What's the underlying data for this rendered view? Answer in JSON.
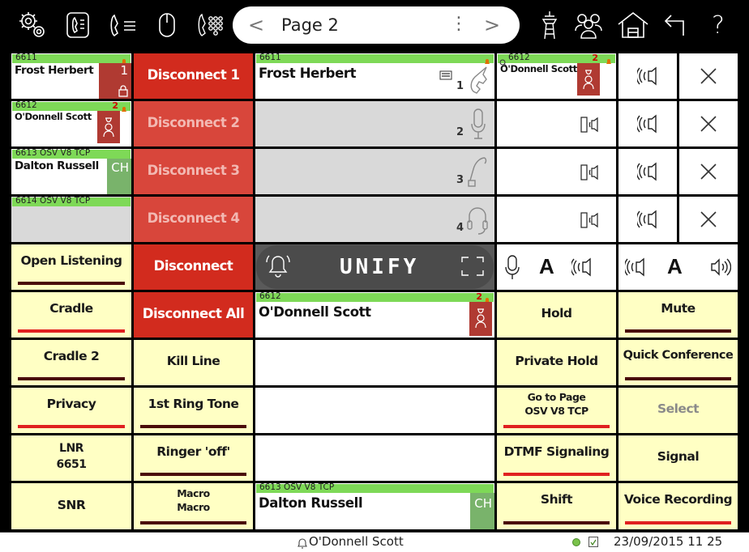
{
  "toolbar": {
    "icons": [
      "settings-icon",
      "phone-handset-icon",
      "call-list-icon",
      "mouse-icon",
      "dialpad-icon",
      "tower-icon",
      "group-icon",
      "home-icon",
      "back-icon",
      "help-icon"
    ],
    "page_title": "Page 2",
    "prev_label": "<",
    "next_label": ">",
    "menu_label": "⋮",
    "help_label": "?"
  },
  "line_keys": [
    {
      "number": "6611",
      "name": "Frost Herbert",
      "status": "1"
    },
    {
      "number": "6612",
      "name": "O'Donnell Scott",
      "status": "2"
    },
    {
      "number": "6613 OSV V8 TCP",
      "name": "Dalton Russell",
      "tag": "CH"
    },
    {
      "number": "6614 OSV V8 TCP",
      "name": ""
    }
  ],
  "disconnect": {
    "d1": "Disconnect 1",
    "d2": "Disconnect 2",
    "d3": "Disconnect 3",
    "d4": "Disconnect 4",
    "d": "Disconnect",
    "all": "Disconnect All"
  },
  "handsets": [
    {
      "number": "6611",
      "name": "Frost Herbert",
      "index": "1"
    },
    {
      "index": "2"
    },
    {
      "index": "3"
    },
    {
      "index": "4"
    }
  ],
  "conference": {
    "number": "6612",
    "name": "O'Donnell Scott",
    "status": "2"
  },
  "mid_panel": {
    "brand": "UNIFY"
  },
  "audio_controls": {
    "a_label": "A",
    "a2_label": "A"
  },
  "function_keys": {
    "col1": [
      "Open Listening",
      "Cradle",
      "Cradle 2",
      "Privacy",
      "LNR",
      "6651",
      "SNR"
    ],
    "col2": [
      "Kill Line",
      "1st Ring Tone",
      "Ringer 'off'",
      "Macro",
      "Macro"
    ],
    "col4": [
      "Hold",
      "Private Hold",
      "Go to Page",
      "OSV V8 TCP",
      "DTMF Signaling",
      "Shift"
    ],
    "col5": [
      "Mute",
      "Quick Conference",
      "Select",
      "Signal",
      "Voice Recording"
    ]
  },
  "bottom_line": {
    "number": "6613 OSV V8 TCP",
    "name": "Dalton Russell",
    "tag": "CH"
  },
  "statusbar": {
    "user": "O'Donnell Scott",
    "datetime": "23/09/2015  11 25"
  },
  "colors": {
    "red": "#d22b1e",
    "yellow": "#ffffc4",
    "green": "#7ed957",
    "dark_bar": "#4a0a0a",
    "red_bar": "#e02020"
  }
}
